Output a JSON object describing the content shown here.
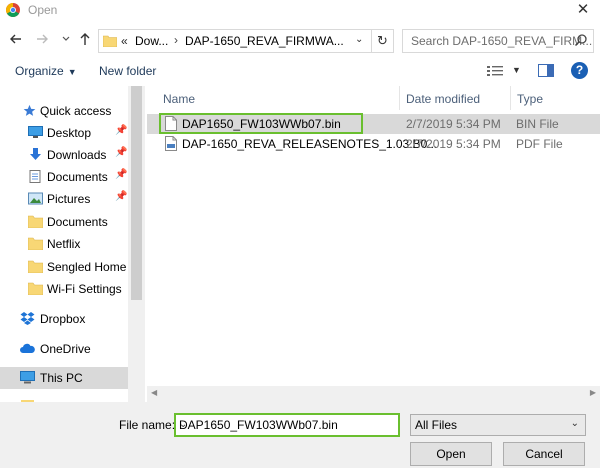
{
  "window": {
    "title": "Open",
    "close_label": "✕"
  },
  "nav": {
    "back_icon": "back-arrow-icon",
    "forward_icon": "forward-arrow-icon",
    "recent_icon": "chevron-down-icon",
    "up_icon": "up-arrow-icon",
    "breadcrumb": [
      "Dow...",
      "DAP-1650_REVA_FIRMWA..."
    ],
    "overflow": "«"
  },
  "search": {
    "placeholder": "Search DAP-1650_REVA_FIRM..."
  },
  "toolbar": {
    "organize": "Organize",
    "new_folder": "New folder"
  },
  "sidebar": {
    "items": [
      {
        "label": "Quick access",
        "icon": "star-icon",
        "pinned": false
      },
      {
        "label": "Desktop",
        "icon": "desktop-icon",
        "pinned": true
      },
      {
        "label": "Downloads",
        "icon": "download-icon",
        "pinned": true
      },
      {
        "label": "Documents",
        "icon": "documents-icon",
        "pinned": true
      },
      {
        "label": "Pictures",
        "icon": "pictures-icon",
        "pinned": true
      },
      {
        "label": "Documents",
        "icon": "folder-icon",
        "pinned": false
      },
      {
        "label": "Netflix",
        "icon": "folder-icon",
        "pinned": false
      },
      {
        "label": "Sengled Home A",
        "icon": "folder-icon",
        "pinned": false
      },
      {
        "label": "Wi-Fi Settings",
        "icon": "folder-icon",
        "pinned": false
      },
      {
        "label": "Dropbox",
        "icon": "dropbox-icon",
        "pinned": false
      },
      {
        "label": "OneDrive",
        "icon": "cloud-icon",
        "pinned": false
      },
      {
        "label": "This PC",
        "icon": "computer-icon",
        "pinned": false
      }
    ]
  },
  "columns": {
    "name": "Name",
    "date": "Date modified",
    "type": "Type"
  },
  "files": [
    {
      "name": "DAP1650_FW103WWb07.bin",
      "date": "2/7/2019 5:34 PM",
      "type": "BIN File",
      "icon": "file-icon"
    },
    {
      "name": "DAP-1650_REVA_RELEASENOTES_1.03.B0...",
      "date": "2/7/2019 5:34 PM",
      "type": "PDF File",
      "icon": "pdf-icon"
    }
  ],
  "bottom": {
    "file_name_label": "File name:",
    "file_name_value": "DAP1650_FW103WWb07.bin",
    "filter": "All Files",
    "open": "Open",
    "cancel": "Cancel"
  },
  "colors": {
    "highlight": "#6abf2f",
    "selection": "#d9d9d9",
    "folder": "#f8d775"
  }
}
